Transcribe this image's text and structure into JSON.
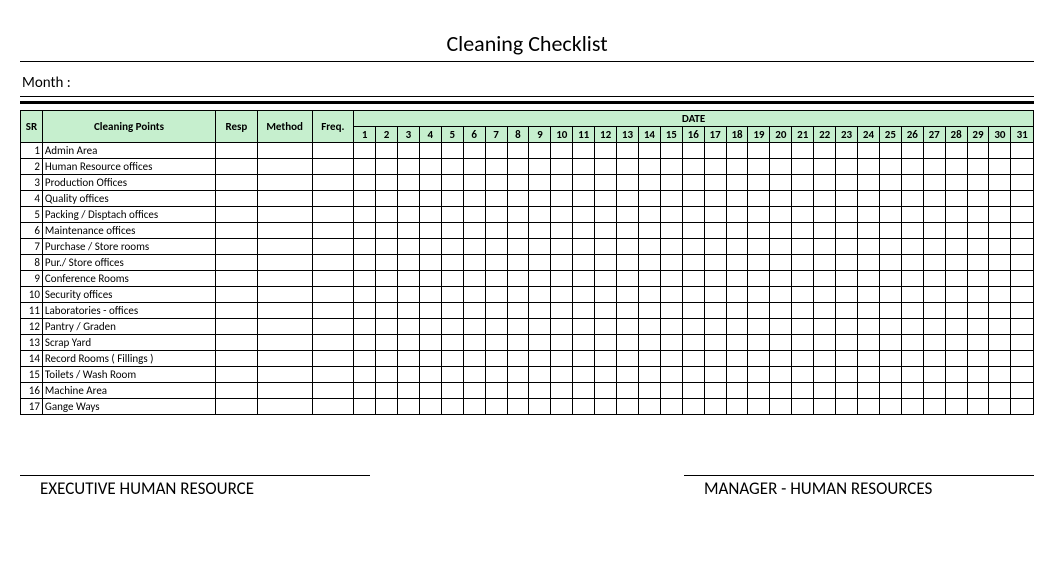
{
  "title": "Cleaning Checklist",
  "month_label": "Month :",
  "headers": {
    "sr": "SR",
    "cleaning_points": "Cleaning Points",
    "resp": "Resp",
    "method": "Method",
    "freq": "Freq.",
    "date": "DATE"
  },
  "days": [
    "1",
    "2",
    "3",
    "4",
    "5",
    "6",
    "7",
    "8",
    "9",
    "10",
    "11",
    "12",
    "13",
    "14",
    "15",
    "16",
    "17",
    "18",
    "19",
    "20",
    "21",
    "22",
    "23",
    "24",
    "25",
    "26",
    "27",
    "28",
    "29",
    "30",
    "31"
  ],
  "rows": [
    {
      "sr": "1",
      "cp": "Admin Area"
    },
    {
      "sr": "2",
      "cp": "Human Resource offices"
    },
    {
      "sr": "3",
      "cp": "Production Offices"
    },
    {
      "sr": "4",
      "cp": "Quality offices"
    },
    {
      "sr": "5",
      "cp": "Packing / Disptach offices"
    },
    {
      "sr": "6",
      "cp": "Maintenance offices"
    },
    {
      "sr": "7",
      "cp": "Purchase / Store rooms"
    },
    {
      "sr": "8",
      "cp": "Pur./ Store offices"
    },
    {
      "sr": "9",
      "cp": "Conference Rooms"
    },
    {
      "sr": "10",
      "cp": "Security offices"
    },
    {
      "sr": "11",
      "cp": "Laboratories - offices"
    },
    {
      "sr": "12",
      "cp": "Pantry / Graden"
    },
    {
      "sr": "13",
      "cp": "Scrap Yard"
    },
    {
      "sr": "14",
      "cp": "Record Rooms ( Fillings )"
    },
    {
      "sr": "15",
      "cp": "Toilets / Wash Room"
    },
    {
      "sr": "16",
      "cp": "Machine Area"
    },
    {
      "sr": "17",
      "cp": "Gange Ways"
    }
  ],
  "signatures": {
    "left": "EXECUTIVE HUMAN RESOURCE",
    "right": "MANAGER - HUMAN RESOURCES"
  }
}
